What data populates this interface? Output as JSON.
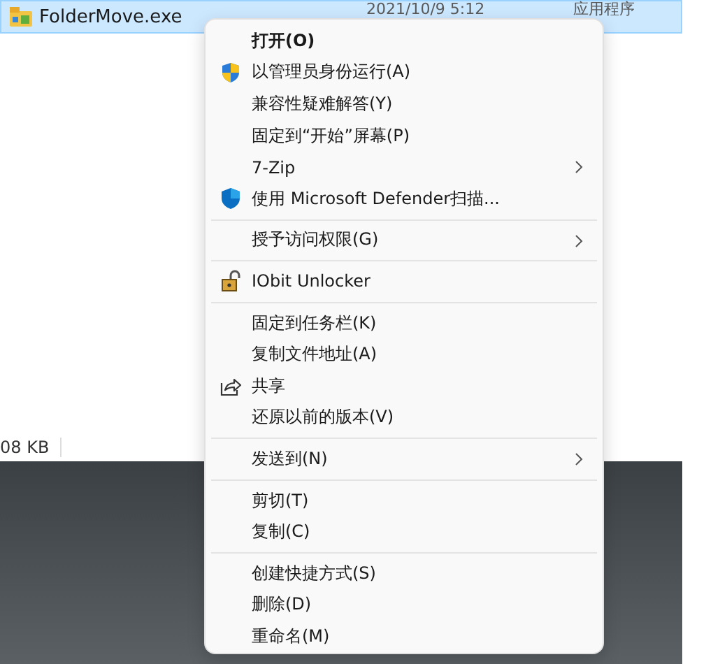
{
  "file_row": {
    "name": "FolderMove.exe",
    "date": "2021/10/9 5:12",
    "type": "应用程序",
    "selected": true
  },
  "size_text": "08 KB",
  "context_menu": {
    "sections": [
      [
        {
          "label": "打开(O)",
          "kind": "none",
          "default": true,
          "submenu": false
        },
        {
          "label": "以管理员身份运行(A)",
          "kind": "uac-shield",
          "default": false,
          "submenu": false
        },
        {
          "label": "兼容性疑难解答(Y)",
          "kind": "none",
          "default": false,
          "submenu": false
        },
        {
          "label": "固定到“开始”屏幕(P)",
          "kind": "none",
          "default": false,
          "submenu": false
        },
        {
          "label": "7-Zip",
          "kind": "none",
          "default": false,
          "submenu": true
        },
        {
          "label": "使用 Microsoft Defender扫描...",
          "kind": "defender",
          "default": false,
          "submenu": false
        }
      ],
      [
        {
          "label": "授予访问权限(G)",
          "kind": "none",
          "default": false,
          "submenu": true
        }
      ],
      [
        {
          "label": "IObit Unlocker",
          "kind": "padlock",
          "default": false,
          "submenu": false
        }
      ],
      [
        {
          "label": "固定到任务栏(K)",
          "kind": "none",
          "default": false,
          "submenu": false
        },
        {
          "label": "复制文件地址(A)",
          "kind": "none",
          "default": false,
          "submenu": false
        },
        {
          "label": "共享",
          "kind": "share",
          "default": false,
          "submenu": false
        },
        {
          "label": "还原以前的版本(V)",
          "kind": "none",
          "default": false,
          "submenu": false
        }
      ],
      [
        {
          "label": "发送到(N)",
          "kind": "none",
          "default": false,
          "submenu": true
        }
      ],
      [
        {
          "label": "剪切(T)",
          "kind": "none",
          "default": false,
          "submenu": false
        },
        {
          "label": "复制(C)",
          "kind": "none",
          "default": false,
          "submenu": false
        }
      ],
      [
        {
          "label": "创建快捷方式(S)",
          "kind": "none",
          "default": false,
          "submenu": false
        },
        {
          "label": "删除(D)",
          "kind": "none",
          "default": false,
          "submenu": false
        },
        {
          "label": "重命名(M)",
          "kind": "none",
          "default": false,
          "submenu": false
        }
      ]
    ]
  }
}
